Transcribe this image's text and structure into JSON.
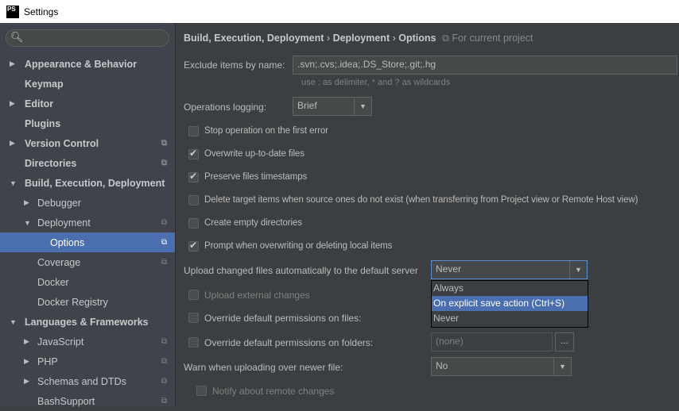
{
  "window": {
    "title": "Settings",
    "icon": "PS"
  },
  "sidebar": {
    "search_placeholder": "",
    "items": [
      {
        "label": "Appearance & Behavior",
        "arrow": "▶"
      },
      {
        "label": "Keymap"
      },
      {
        "label": "Editor",
        "arrow": "▶"
      },
      {
        "label": "Plugins"
      },
      {
        "label": "Version Control",
        "arrow": "▶"
      },
      {
        "label": "Directories"
      },
      {
        "label": "Build, Execution, Deployment",
        "arrow": "▼"
      },
      {
        "label": "Debugger",
        "arrow": "▶"
      },
      {
        "label": "Deployment",
        "arrow": "▼"
      },
      {
        "label": "Options"
      },
      {
        "label": "Coverage"
      },
      {
        "label": "Docker"
      },
      {
        "label": "Docker Registry"
      },
      {
        "label": "Languages & Frameworks",
        "arrow": "▼"
      },
      {
        "label": "JavaScript",
        "arrow": "▶"
      },
      {
        "label": "PHP",
        "arrow": "▶"
      },
      {
        "label": "Schemas and DTDs",
        "arrow": "▶"
      },
      {
        "label": "BashSupport"
      }
    ]
  },
  "breadcrumb": {
    "part1": "Build, Execution, Deployment",
    "sep": "›",
    "part2": "Deployment",
    "part3": "Options",
    "scope": "For current project"
  },
  "form": {
    "exclude_label": "Exclude items by name:",
    "exclude_value": ".svn;.cvs;.idea;.DS_Store;.git;.hg",
    "exclude_hint": "use ; as delimiter, * and ? as wildcards",
    "logging_label": "Operations logging:",
    "logging_value": "Brief",
    "checkboxes": [
      {
        "label": "Stop operation on the first error",
        "checked": false
      },
      {
        "label": "Overwrite up-to-date files",
        "checked": true
      },
      {
        "label": "Preserve files timestamps",
        "checked": true
      },
      {
        "label": "Delete target items when source ones do not exist (when transferring from Project view or Remote Host view)",
        "checked": false
      },
      {
        "label": "Create empty directories",
        "checked": false
      },
      {
        "label": "Prompt when overwriting or deleting local items",
        "checked": true
      }
    ],
    "upload_label": "Upload changed files automatically to the default server",
    "upload_value": "Never",
    "upload_options": [
      "Always",
      "On explicit save action (Ctrl+S)",
      "Never"
    ],
    "upload_external": "Upload external changes",
    "override_files": "Override default permissions on files:",
    "override_folders": "Override default permissions on folders:",
    "folders_value": "(none)",
    "browse": "...",
    "warn_label": "Warn when uploading over newer file:",
    "warn_value": "No",
    "notify": "Notify about remote changes"
  }
}
